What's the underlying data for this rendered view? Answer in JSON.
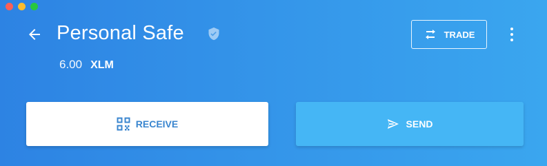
{
  "window": {
    "controls": [
      "close",
      "minimize",
      "zoom"
    ]
  },
  "header": {
    "back_icon": "arrow-left-icon",
    "title": "Personal Safe",
    "verified_icon": "shield-check-icon",
    "balance": {
      "amount": "6.00",
      "asset": "XLM"
    },
    "trade_button": {
      "label": "TRADE",
      "icon": "swap-arrows-icon"
    },
    "more_icon": "more-vertical-icon"
  },
  "actions": {
    "receive": {
      "label": "RECEIVE",
      "icon": "qr-code-icon"
    },
    "send": {
      "label": "SEND",
      "icon": "send-icon"
    }
  },
  "colors": {
    "background_start": "#2d83e3",
    "background_end": "#3aa6ef",
    "receive_bg": "#ffffff",
    "receive_text": "#3a86cf",
    "send_bg": "#45b6f5",
    "verified_badge": "#9ecbf5"
  }
}
